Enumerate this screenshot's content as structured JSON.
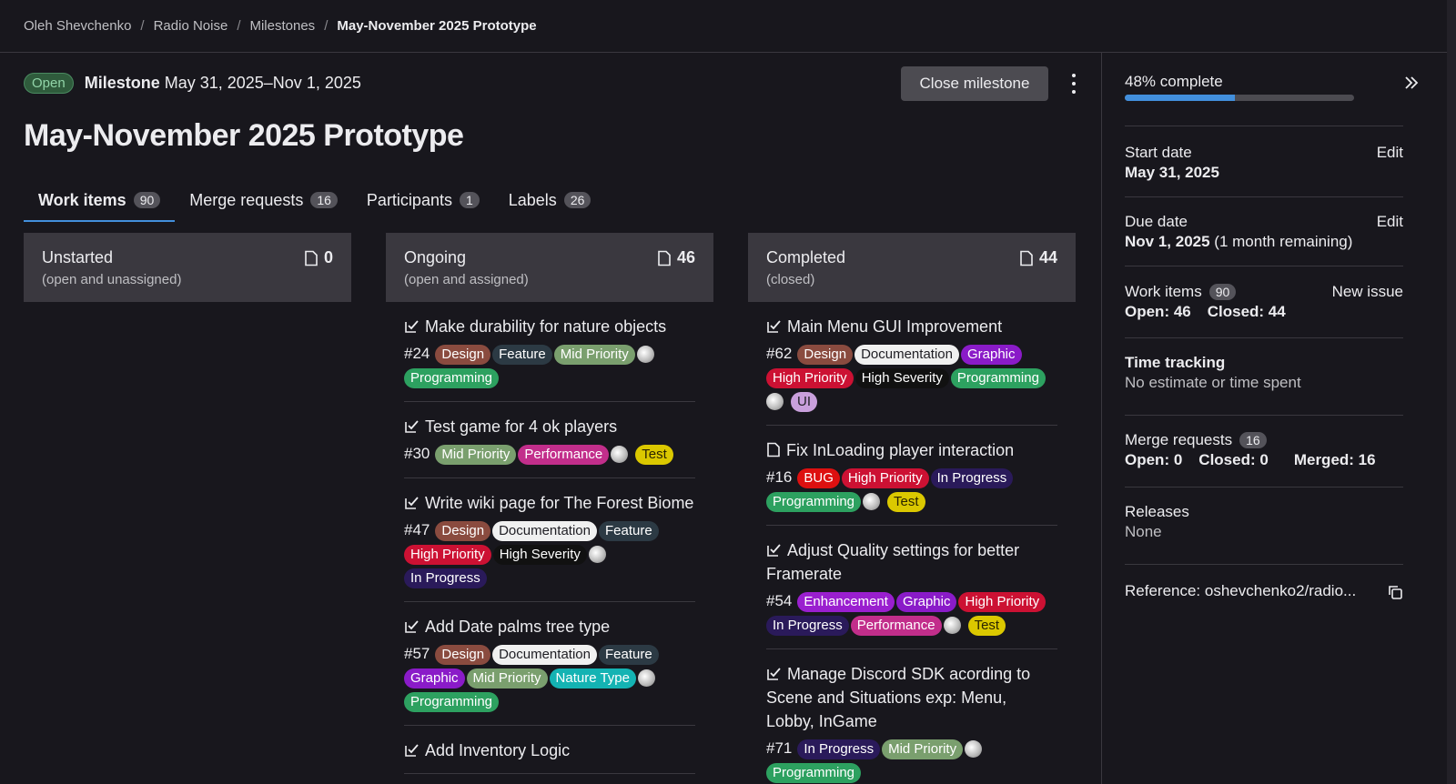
{
  "breadcrumb": [
    "Oleh Shevchenko",
    "Radio Noise",
    "Milestones",
    "May-November 2025 Prototype"
  ],
  "milestone": {
    "status": "Open",
    "label": "Milestone",
    "date_range": "May 31, 2025–Nov 1, 2025",
    "title": "May-November 2025 Prototype",
    "close_label": "Close milestone"
  },
  "tabs": [
    {
      "label": "Work items",
      "count": "90"
    },
    {
      "label": "Merge requests",
      "count": "16"
    },
    {
      "label": "Participants",
      "count": "1"
    },
    {
      "label": "Labels",
      "count": "26"
    }
  ],
  "colors": {
    "Design": "#8a4b3f",
    "Feature": "#2c3a44",
    "Mid Priority": "#7a9f6e",
    "Programming": "#2da160",
    "Performance": "#c22e8b",
    "Test": "#dbc800",
    "Documentation": "#f0f0f0",
    "High Priority": "#cc1133",
    "High Severity": "#111111",
    "In Progress": "#2a1a5a",
    "Graphic": "#8a1bc8",
    "Nature Type": "#14b3b3",
    "UI": "#c9a0dc",
    "BUG": "#dd1010",
    "Enhancement": "#9a1fcf"
  },
  "columns": [
    {
      "title": "Unstarted",
      "subtitle": "(open and unassigned)",
      "count": "0",
      "cards": []
    },
    {
      "title": "Ongoing",
      "subtitle": "(open and assigned)",
      "count": "46",
      "cards": [
        {
          "title": "Make durability for nature objects",
          "iid": "#24",
          "icon": "check",
          "labels": [
            "Design",
            "Feature",
            "Mid Priority",
            "Programming"
          ]
        },
        {
          "title": "Test game for 4 ok players",
          "iid": "#30",
          "icon": "check",
          "labels": [
            "Mid Priority",
            "Performance",
            "Test"
          ]
        },
        {
          "title": "Write wiki page for The Forest Biome",
          "iid": "#47",
          "icon": "check",
          "labels": [
            "Design",
            "Documentation",
            "Feature",
            "High Priority",
            "High Severity",
            "In Progress"
          ]
        },
        {
          "title": "Add Date palms tree type",
          "iid": "#57",
          "icon": "check",
          "labels": [
            "Design",
            "Documentation",
            "Feature",
            "Graphic",
            "Mid Priority",
            "Nature Type",
            "Programming"
          ]
        },
        {
          "title": "Add Inventory Logic",
          "iid": "",
          "icon": "check",
          "labels": []
        }
      ]
    },
    {
      "title": "Completed",
      "subtitle": "(closed)",
      "count": "44",
      "cards": [
        {
          "title": "Main Menu GUI Improvement",
          "iid": "#62",
          "icon": "check",
          "labels": [
            "Design",
            "Documentation",
            "Graphic",
            "High Priority",
            "High Severity",
            "Programming",
            "UI"
          ]
        },
        {
          "title": "Fix InLoading player interaction",
          "iid": "#16",
          "icon": "issue",
          "labels": [
            "BUG",
            "High Priority",
            "In Progress",
            "Programming",
            "Test"
          ]
        },
        {
          "title": "Adjust Quality settings for better Framerate",
          "iid": "#54",
          "icon": "check",
          "labels": [
            "Enhancement",
            "Graphic",
            "High Priority",
            "In Progress",
            "Performance",
            "Test"
          ]
        },
        {
          "title": "Manage Discord SDK acording to Scene and Situations exp: Menu, Lobby, InGame",
          "iid": "#71",
          "icon": "check",
          "labels": [
            "In Progress",
            "Mid Priority",
            "Programming"
          ]
        }
      ]
    }
  ],
  "sidebar": {
    "complete_label": "48% complete",
    "progress": 0.48,
    "start": {
      "label": "Start date",
      "value": "May 31, 2025",
      "edit": "Edit"
    },
    "due": {
      "label": "Due date",
      "value": "Nov 1, 2025",
      "note": " (1 month remaining)",
      "edit": "Edit"
    },
    "work_items": {
      "label": "Work items",
      "count": "90",
      "action": "New issue",
      "open": "Open: 46",
      "closed": "Closed: 44"
    },
    "time_tracking": {
      "label": "Time tracking",
      "value": "No estimate or time spent"
    },
    "merge_requests": {
      "label": "Merge requests",
      "count": "16",
      "open": "Open: 0",
      "closed": "Closed: 0",
      "merged": "Merged: 16"
    },
    "releases": {
      "label": "Releases",
      "value": "None"
    },
    "reference": "Reference: oshevchenko2/radio..."
  }
}
